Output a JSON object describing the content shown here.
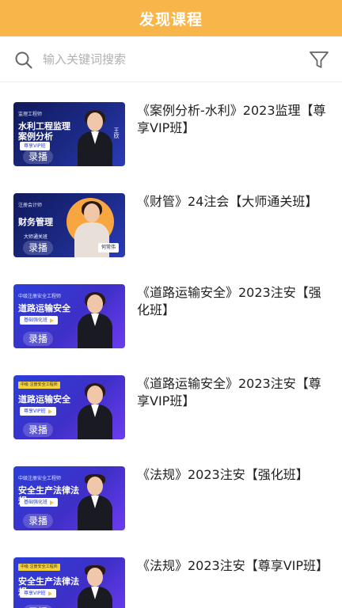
{
  "header": {
    "title": "发现课程"
  },
  "search": {
    "placeholder": "输入关键词搜索",
    "value": ""
  },
  "icons": {
    "search": "search-icon",
    "filter": "filter-icon"
  },
  "colors": {
    "header_bg": "#f8b54a",
    "thumb_blue": "#2b3fd8",
    "badge_yellow": "#f6d13a"
  },
  "courses": [
    {
      "title": "《案例分析-水利》2023监理【尊享VIP班】",
      "badge": "录播",
      "thumb_tag": "监理工程师",
      "thumb_heading": "水利工程监理\n案例分析",
      "thumb_pill": "尊享VIP班",
      "teacher": "王欣"
    },
    {
      "title": "《财管》24注会【大师通关班】",
      "badge": "录播",
      "thumb_tag": "注册会计师",
      "thumb_heading": "财务管理",
      "thumb_pill": "大师通关班",
      "teacher": "何常伟"
    },
    {
      "title": "《道路运输安全》2023注安【强化班】",
      "badge": "录播",
      "thumb_tag": "中级注册安全工程师",
      "thumb_heading": "道路运输安全",
      "thumb_pill": "基础强化班",
      "teacher": ""
    },
    {
      "title": "《道路运输安全》2023注安【尊享VIP班】",
      "badge": "录播",
      "thumb_tag": "中级 注册安全工程师",
      "thumb_heading": "道路运输安全",
      "thumb_pill": "尊享VIP班",
      "teacher": ""
    },
    {
      "title": "《法规》2023注安【强化班】",
      "badge": "录播",
      "thumb_tag": "中级注册安全工程师",
      "thumb_heading": "安全生产法律法规",
      "thumb_pill": "基础强化班",
      "teacher": ""
    },
    {
      "title": "《法规》2023注安【尊享VIP班】",
      "badge": "录播",
      "thumb_tag": "中级 注册安全工程师",
      "thumb_heading": "安全生产法律法规",
      "thumb_pill": "尊享VIP班",
      "teacher": ""
    }
  ]
}
